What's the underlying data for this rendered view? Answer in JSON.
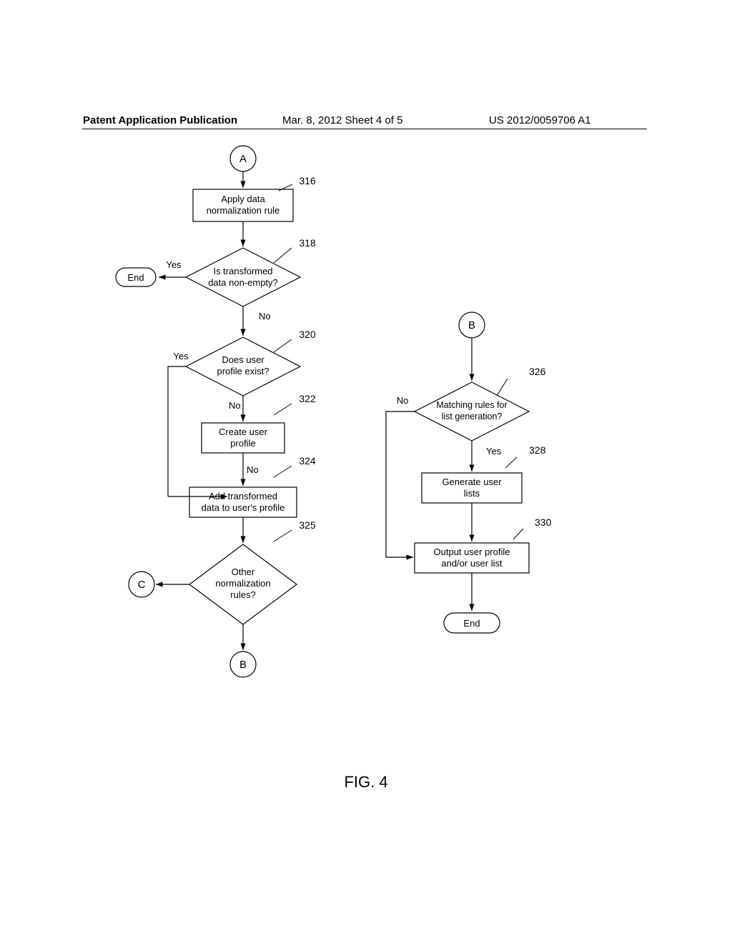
{
  "header": {
    "left": "Patent Application Publication",
    "mid": "Mar. 8, 2012  Sheet 4 of 5",
    "right": "US 2012/0059706 A1"
  },
  "figure_caption": "FIG. 4",
  "nodes": {
    "connA": "A",
    "connB": "B",
    "connB2": "B",
    "connC": "C",
    "end1": "End",
    "end2": "End",
    "step316": "Apply data\nnormalization rule",
    "step318": "Is transformed\ndata non-empty?",
    "step320": "Does user\nprofile exist?",
    "step322": "Create user\nprofile",
    "step324": "Add transformed\ndata to user's profile",
    "step325": "Other\nnormalization\nrules?",
    "step326": "Matching rules for\nlist generation?",
    "step328": "Generate user\nlists",
    "step330": "Output user profile\nand/or user list"
  },
  "labels": {
    "ref316": "316",
    "ref318": "318",
    "ref320": "320",
    "ref322": "322",
    "ref324": "324",
    "ref325": "325",
    "ref326": "326",
    "ref328": "328",
    "ref330": "330",
    "yes": "Yes",
    "no": "No"
  }
}
